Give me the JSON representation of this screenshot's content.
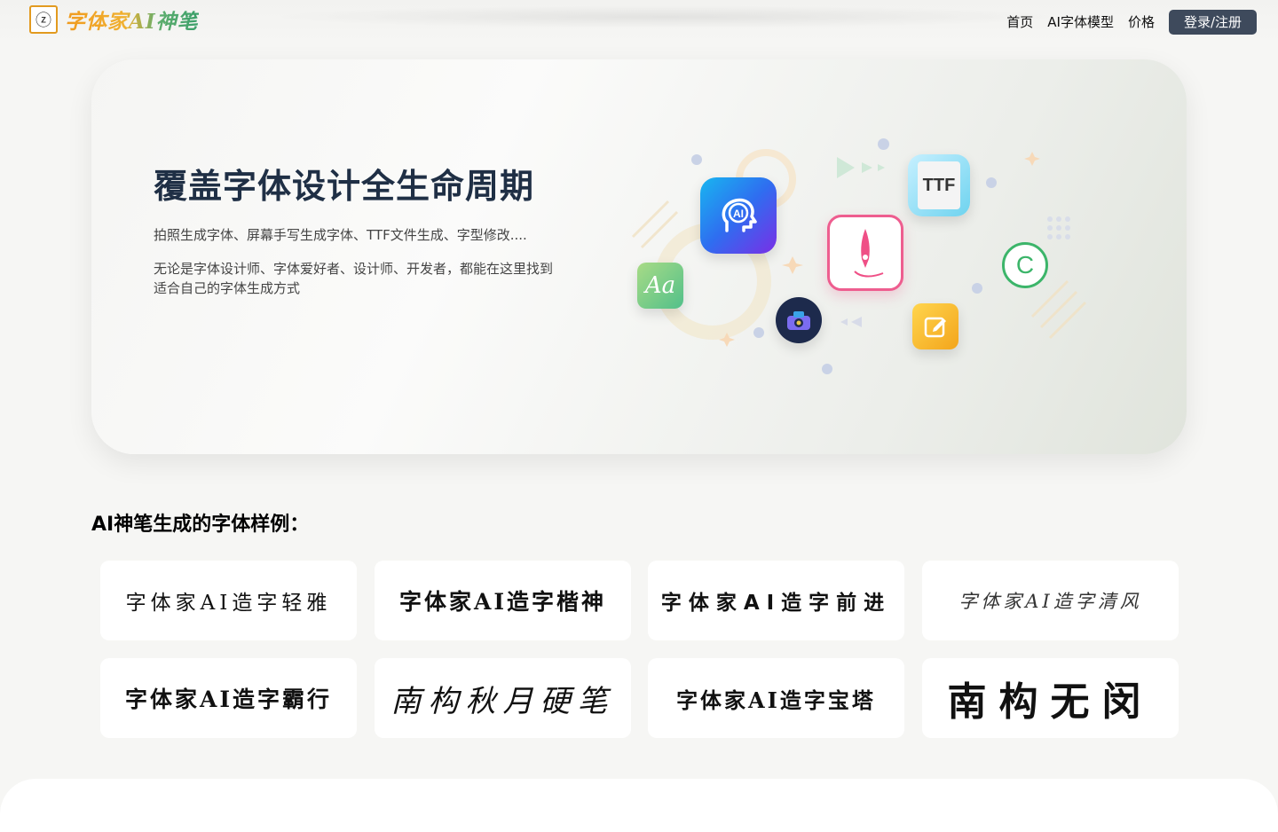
{
  "header": {
    "logo_mark": "ⓩ",
    "logo_text": "字体家AI神笔",
    "nav": [
      "首页",
      "AI字体模型",
      "价格"
    ],
    "login_label": "登录/注册"
  },
  "hero": {
    "title": "覆盖字体设计全生命周期",
    "subtitle": "拍照生成字体、屏幕手写生成字体、TTF文件生成、字型修改....",
    "description": "无论是字体设计师、字体爱好者、设计师、开发者，都能在这里找到适合自己的字体生成方式",
    "icons": {
      "ai": "AI",
      "ttf": "TTF",
      "aa": "Aa",
      "copyright": "C"
    }
  },
  "samples": {
    "title": "AI神笔生成的字体样例：",
    "items": [
      "字体家AI造字轻雅",
      "字体家AI造字楷神",
      "字体家AI造字前进",
      "字体家AI造字清风",
      "字体家AI造字霸行",
      "南构秋月硬笔",
      "字体家AI造字宝塔",
      "南构无闵"
    ]
  }
}
